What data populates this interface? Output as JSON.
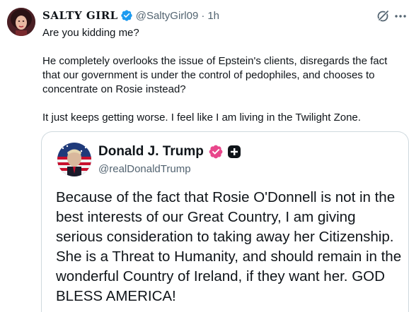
{
  "author": {
    "display_name": "SALTY GIRL",
    "handle": "@SaltyGirl09",
    "separator": "·",
    "time": "1h"
  },
  "tweet": {
    "line1": "Are you kidding me?",
    "paragraph2": "He completely overlooks the issue of Epstein's clients, disregards the fact that our government is under the control of pedophiles, and chooses to concentrate on Rosie instead?",
    "paragraph3": "It just keeps getting worse. I feel like I am living in the Twilight Zone."
  },
  "quoted_post": {
    "display_name": "Donald J. Trump",
    "handle": "@realDonaldTrump",
    "text": "Because of the fact that Rosie O'Donnell is not in the best interests of our Great Country, I am giving serious consideration to taking away her Citizenship. She is a Threat to Humanity, and should remain in the wonderful Country of Ireland, if they want her. GOD BLESS AMERICA!"
  },
  "icons": {
    "verified": "verified-badge-icon",
    "grok": "grok-icon",
    "more": "more-options-icon",
    "pink_badge": "pink-verified-badge-icon",
    "plus": "plus-badge-icon"
  },
  "colors": {
    "verified_blue": "#1d9bf0",
    "badge_pink": "#e8478b",
    "secondary_text": "#536471",
    "border": "#cfd9de"
  }
}
